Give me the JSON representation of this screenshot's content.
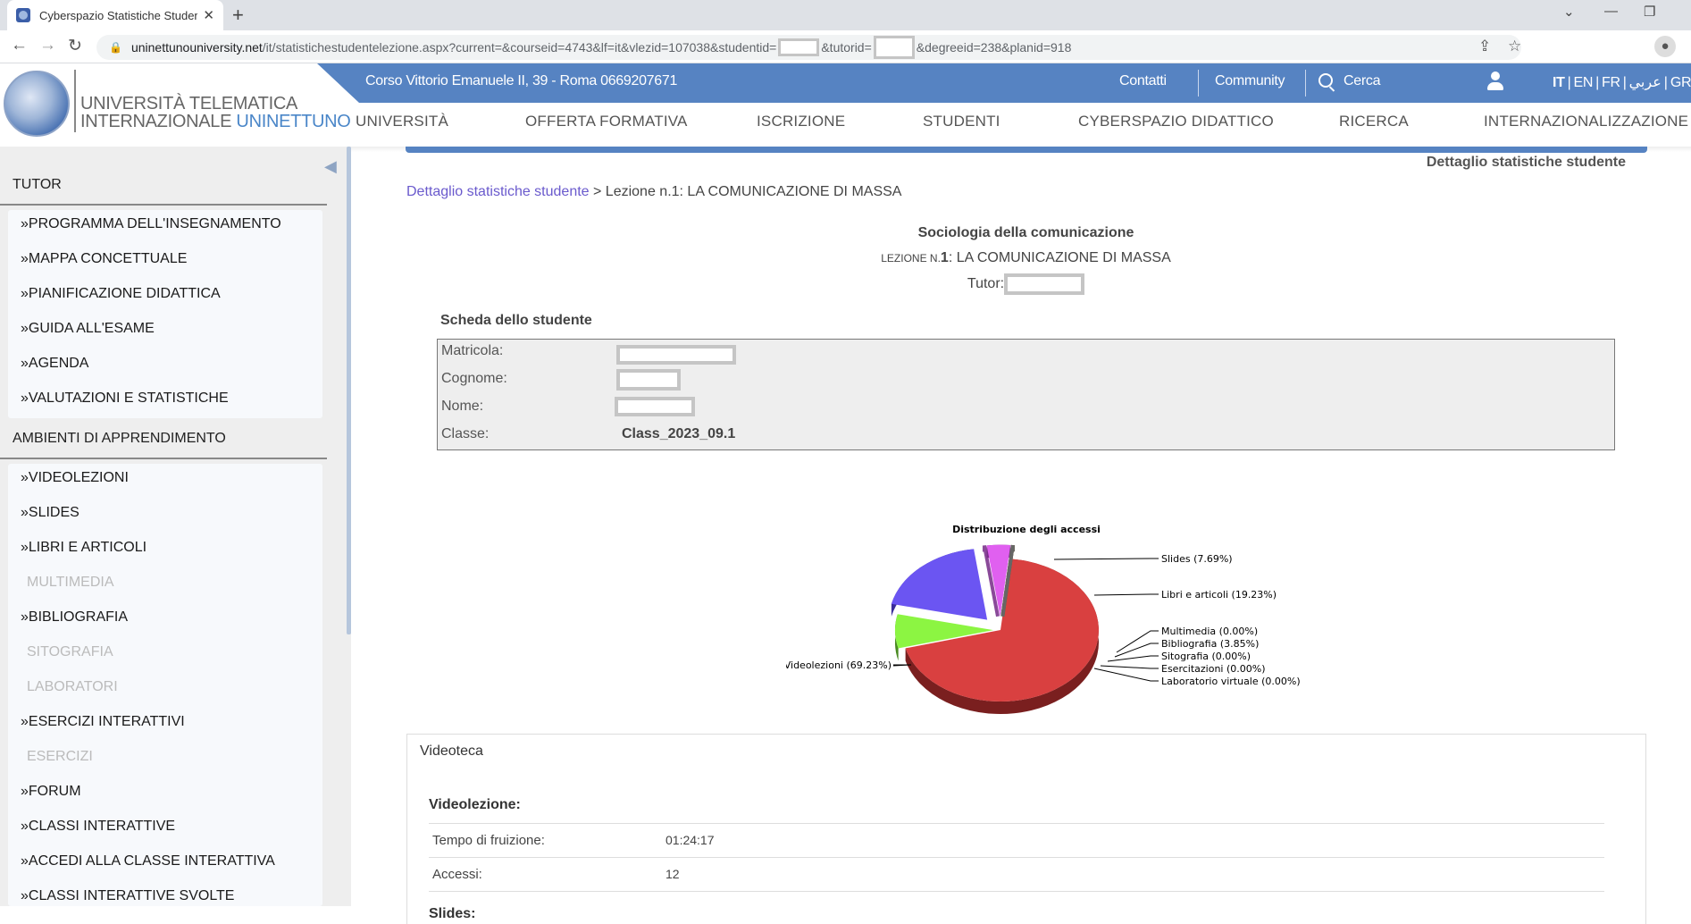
{
  "browser": {
    "tab_title": "Cyberspazio Statistiche Studente",
    "url_host": "uninettunouniversity.net",
    "url_path_1": "/it/statistichestudentelezione.aspx?current=&courseid=4743&lf=it&vlezid=107038&studentid=",
    "url_path_2": "&tutorid=",
    "url_path_3": "&degreeid=238&planid=918",
    "icons": {
      "back": "←",
      "forward": "→",
      "reload": "↻",
      "lock": "🔒",
      "share": "⇪",
      "star": "☆",
      "newtab": "+",
      "close": "✕",
      "chevron": "⌄",
      "minimize": "—",
      "restore": "❐",
      "profile": "●"
    }
  },
  "header": {
    "logo_line1": "UNIVERSITÀ TELEMATICA",
    "logo_line2a": "INTERNAZIONALE ",
    "logo_line2b": "UNINETTUNO",
    "address": "Corso Vittorio Emanuele II, 39 - Roma 0669207671",
    "links": {
      "contatti": "Contatti",
      "community": "Community",
      "cerca": "Cerca"
    },
    "languages": [
      "IT",
      "EN",
      "FR",
      "عربي",
      "GR"
    ],
    "nav": [
      "UNIVERSITÀ",
      "OFFERTA FORMATIVA",
      "ISCRIZIONE",
      "STUDENTI",
      "CYBERSPAZIO DIDATTICO",
      "RICERCA",
      "INTERNAZIONALIZZAZIONE"
    ]
  },
  "sidebar": {
    "toggle_icon": "◀",
    "section1": "TUTOR",
    "tutor_items": [
      "»PROGRAMMA DELL'INSEGNAMENTO",
      "»MAPPA CONCETTUALE",
      "»PIANIFICAZIONE DIDATTICA",
      "»GUIDA ALL'ESAME",
      "»AGENDA",
      "»VALUTAZIONI E STATISTICHE"
    ],
    "section2": "AMBIENTI DI APPRENDIMENTO",
    "amb_items": [
      {
        "label": "»VIDEOLEZIONI",
        "enabled": true
      },
      {
        "label": "»SLIDES",
        "enabled": true
      },
      {
        "label": "»LIBRI E ARTICOLI",
        "enabled": true
      },
      {
        "label": "MULTIMEDIA",
        "enabled": false
      },
      {
        "label": "»BIBLIOGRAFIA",
        "enabled": true
      },
      {
        "label": "SITOGRAFIA",
        "enabled": false
      },
      {
        "label": "LABORATORI",
        "enabled": false
      },
      {
        "label": "»ESERCIZI INTERATTIVI",
        "enabled": true
      },
      {
        "label": "ESERCIZI",
        "enabled": false
      },
      {
        "label": "»FORUM",
        "enabled": true
      },
      {
        "label": "»CLASSI INTERATTIVE",
        "enabled": true
      },
      {
        "label": "»ACCEDI ALLA CLASSE INTERATTIVA",
        "enabled": true
      },
      {
        "label": "»CLASSI INTERATTIVE SVOLTE",
        "enabled": true
      }
    ]
  },
  "content": {
    "page_label": "Dettaglio statistiche studente",
    "breadcrumb_link": "Dettaglio statistiche studente",
    "breadcrumb_rest": " > Lezione n.1: LA COMUNICAZIONE DI MASSA",
    "course_title": "Sociologia della comunicazione",
    "lesson_prefix": "Lezione n.",
    "lesson_num": "1",
    "lesson_title": ": LA COMUNICAZIONE DI MASSA",
    "tutor_label": "Tutor:",
    "scheda_title": "Scheda dello studente",
    "scheda": [
      {
        "label": "Matricola:",
        "value": "",
        "redacted": true
      },
      {
        "label": "Cognome:",
        "value": "",
        "redacted": true
      },
      {
        "label": "Nome:",
        "value": "",
        "redacted": true
      },
      {
        "label": "Classe:",
        "value": "Class_2023_09.1",
        "redacted": false
      }
    ]
  },
  "chart_data": {
    "type": "pie",
    "title": "Distribuzione degli accessi",
    "slices": [
      {
        "label": "Videolezioni",
        "value": 69.23,
        "color": "#d94040",
        "dark": "#7a1f1f"
      },
      {
        "label": "Slides",
        "value": 7.69,
        "color": "#8cf542",
        "dark": "#4a8a22"
      },
      {
        "label": "Libri e articoli",
        "value": 19.23,
        "color": "#6b55f2",
        "dark": "#3a2c99"
      },
      {
        "label": "Multimedia",
        "value": 0.0,
        "color": "#e08cf0",
        "dark": "#8a4a99"
      },
      {
        "label": "Bibliografia",
        "value": 3.85,
        "color": "#e060f0",
        "dark": "#7a2f8a"
      },
      {
        "label": "Sitografia",
        "value": 0.0,
        "color": "#888888",
        "dark": "#555555"
      },
      {
        "label": "Esercitazioni",
        "value": 0.0,
        "color": "#c8b040",
        "dark": "#7a6a20"
      },
      {
        "label": "Laboratorio virtuale",
        "value": 0.0,
        "color": "#999999",
        "dark": "#666666"
      }
    ],
    "legend": "labels with leader lines"
  },
  "videoteca": {
    "title": "Videoteca",
    "sections": [
      {
        "name": "Videolezione:",
        "rows": [
          {
            "k": "Tempo di fruizione:",
            "v": "01:24:17"
          },
          {
            "k": "Accessi:",
            "v": "12"
          }
        ]
      },
      {
        "name": "Slides:",
        "rows": []
      }
    ]
  }
}
